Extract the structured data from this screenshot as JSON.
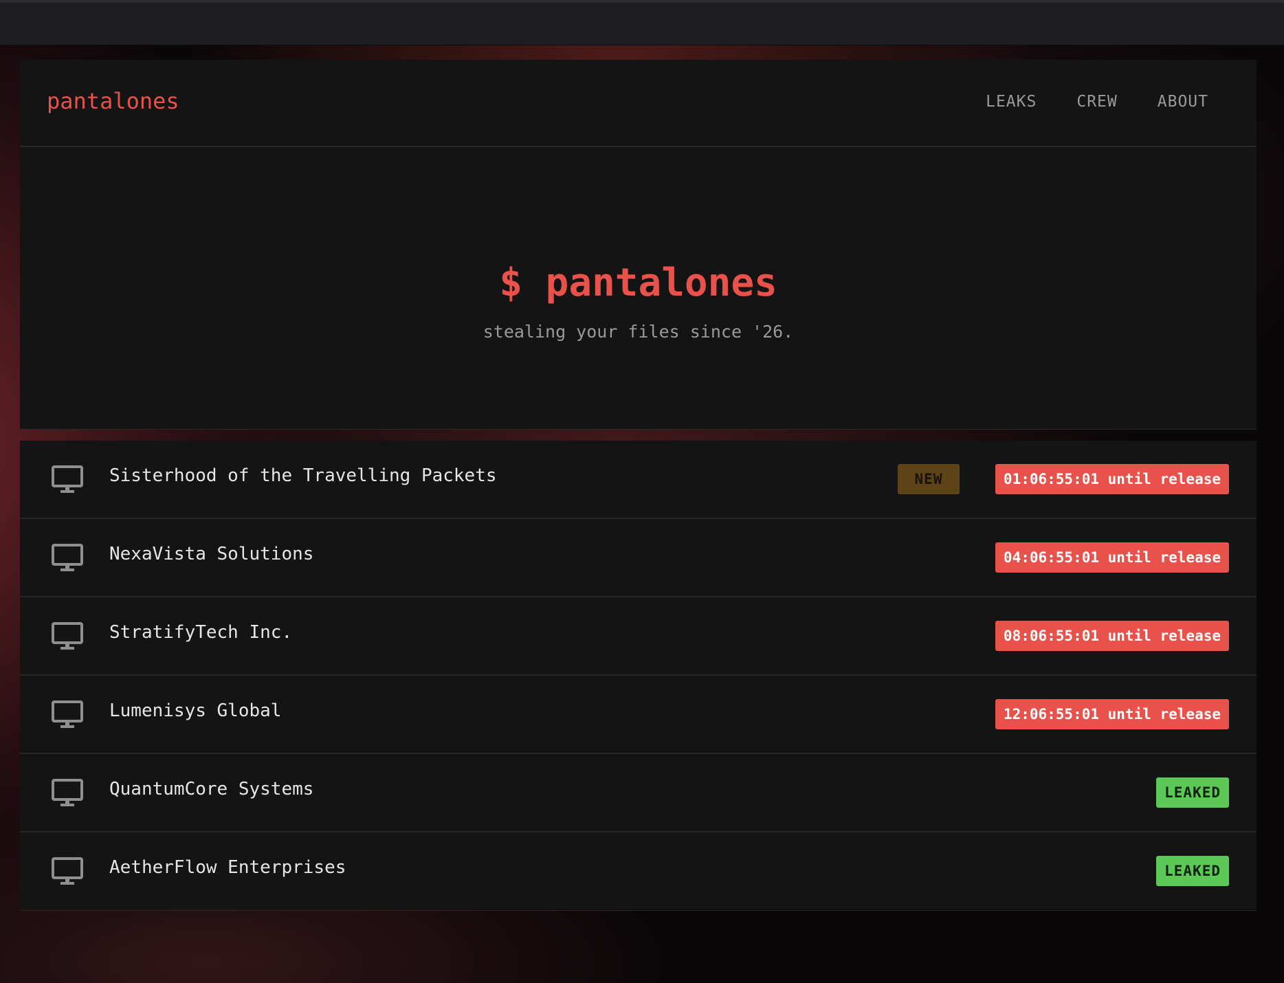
{
  "nav": {
    "brand": "pantalones",
    "links": [
      "LEAKS",
      "CREW",
      "ABOUT"
    ]
  },
  "hero": {
    "title": "$ pantalones",
    "subtitle": "stealing your files since '26."
  },
  "colors": {
    "accent": "#e8524a",
    "leaked": "#5cc855",
    "new_badge": "#5e4316",
    "panel": "#141414"
  },
  "leaks": [
    {
      "name": "Sisterhood of the Travelling Packets",
      "new": "NEW",
      "status": "01:06:55:01 until release",
      "type": "release"
    },
    {
      "name": "NexaVista Solutions",
      "status": "04:06:55:01 until release",
      "type": "release"
    },
    {
      "name": "StratifyTech Inc.",
      "status": "08:06:55:01 until release",
      "type": "release"
    },
    {
      "name": "Lumenisys Global",
      "status": "12:06:55:01 until release",
      "type": "release"
    },
    {
      "name": "QuantumCore Systems",
      "status": "LEAKED",
      "type": "leaked"
    },
    {
      "name": "AetherFlow Enterprises",
      "status": "LEAKED",
      "type": "leaked"
    }
  ]
}
